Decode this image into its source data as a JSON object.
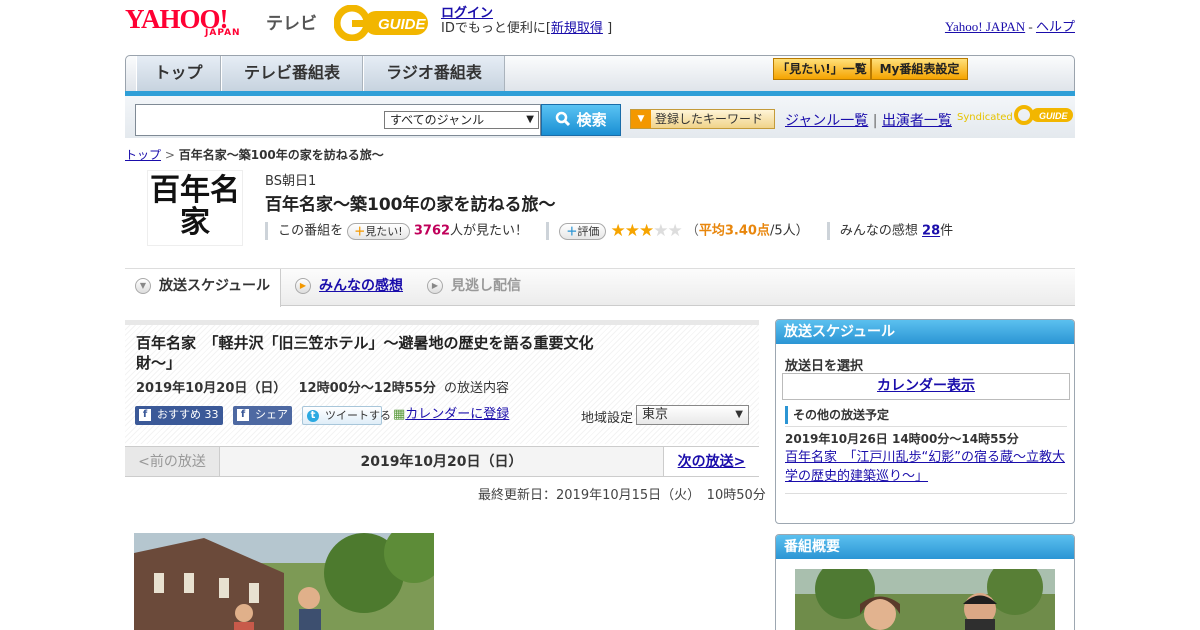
{
  "header": {
    "logo_yahoo": "YAHOO!",
    "logo_japan": "JAPAN",
    "logo_tv": "テレビ",
    "gguide_logo": "G GUIDE",
    "login_label": "ログイン",
    "id_text": "IDでもっと便利に[",
    "register_link": "新規取得",
    "id_text_end": "]",
    "yahoo_japan_link": "Yahoo! JAPAN",
    "separator": "-",
    "help_link": "ヘルプ"
  },
  "nav": {
    "tabs": [
      "トップ",
      "テレビ番組表",
      "ラジオ番組表"
    ],
    "want_list_btn": "「見たい!」一覧",
    "my_schedule_btn": "My番組表設定"
  },
  "search": {
    "genre_value": "すべてのジャンル",
    "search_btn": "検索",
    "keyword_btn": "登録したキーワード",
    "genre_list_link": "ジャンル一覧",
    "divider": "|",
    "performer_list_link": "出演者一覧",
    "syndicated": "Syndicated"
  },
  "breadcrumb": {
    "top": "トップ",
    "sep": ">",
    "current": "百年名家～築100年の家を訪ねる旅～"
  },
  "program": {
    "logo_text": "百年名家",
    "channel": "BS朝日1",
    "title": "百年名家～築100年の家を訪ねる旅～",
    "this_program": "この番組を",
    "want_btn": "見たい!",
    "want_count": "3762",
    "want_suffix": "人が見たい！",
    "rate_btn": "評価",
    "rating": 3.4,
    "rating_open": "（",
    "rating_avg_label": "平均3.40点",
    "rating_count": "/5人）",
    "impressions_label": "みんなの感想",
    "impressions_count": "28",
    "impressions_suffix": "件"
  },
  "tabs": {
    "schedule": "放送スケジュール",
    "impressions": "みんなの感想",
    "catchup": "見逃し配信"
  },
  "episode": {
    "title": "百年名家　「軽井沢「旧三笠ホテル」～避暑地の歴史を語る重要文化財～」",
    "date": "2019年10月20日（日）",
    "time": "12時00分～12時55分",
    "suffix": "の放送内容",
    "recommend_btn": "おすすめ",
    "recommend_count": "33",
    "share_btn": "シェア",
    "tweet_btn": "ツイートする",
    "calendar_link": "カレンダーに登録",
    "region_label": "地域設定",
    "region_value": "東京",
    "prev": "<前の放送",
    "current": "2019年10月20日（日）",
    "next": "次の放送>",
    "updated": "最終更新日：2019年10月15日（火）　10時50分"
  },
  "sidebar": {
    "schedule_title": "放送スケジュール",
    "select_date": "放送日を選択",
    "calendar_btn": "カレンダー表示",
    "other_label": "その他の放送予定",
    "other_date": "2019年10月26日  14時00分～14時55分",
    "other_title": "百年名家　「江戸川乱歩“幻影”の宿る蔵～立教大学の歴史的建築巡り～」",
    "overview_title": "番組概要"
  }
}
